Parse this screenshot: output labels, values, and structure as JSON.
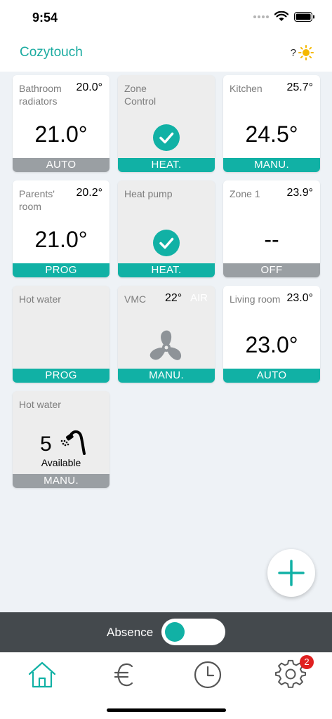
{
  "status_bar": {
    "time": "9:54"
  },
  "header": {
    "title": "Cozytouch",
    "weather_text": "?"
  },
  "tiles": [
    {
      "name": "Bathroom radiators",
      "temp": "20.0°",
      "setpoint": "21.0°",
      "mode": "AUTO",
      "mode_color": "#9a9fa3"
    },
    {
      "name": "Zone Control",
      "mode": "HEAT.",
      "mode_color": "#11b1a5"
    },
    {
      "name": "Kitchen",
      "temp": "25.7°",
      "setpoint": "24.5°",
      "mode": "MANU.",
      "mode_color": "#11b1a5"
    },
    {
      "name": "Parents' room",
      "temp": "20.2°",
      "setpoint": "21.0°",
      "mode": "PROG",
      "mode_color": "#11b1a5"
    },
    {
      "name": "Heat pump",
      "mode": "HEAT.",
      "mode_color": "#11b1a5"
    },
    {
      "name": "Zone 1",
      "temp": "23.9°",
      "setpoint": "--",
      "mode": "OFF",
      "mode_color": "#9a9fa3"
    },
    {
      "name": "Hot water",
      "mode": "PROG",
      "mode_color": "#11b1a5"
    },
    {
      "name": "VMC",
      "temp": "22°",
      "air_label": "AIR",
      "mode": "MANU.",
      "mode_color": "#11b1a5"
    },
    {
      "name": "Living room",
      "temp": "23.0°",
      "setpoint": "23.0°",
      "mode": "AUTO",
      "mode_color": "#11b1a5"
    },
    {
      "name": "Hot water",
      "showers": "5",
      "available_label": "Available",
      "mode": "MANU.",
      "mode_color": "#9a9fa3"
    }
  ],
  "absence": {
    "label": "Absence",
    "enabled": true
  },
  "tabbar": {
    "icons": [
      "home-icon",
      "euro-icon",
      "clock-icon",
      "gear-icon"
    ],
    "settings_badge": "2"
  },
  "colors": {
    "accent": "#11b1a5",
    "inactive": "#9a9fa3",
    "bar": "#44494d"
  }
}
